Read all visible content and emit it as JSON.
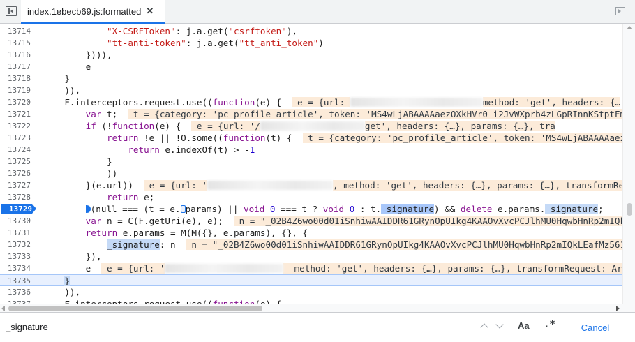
{
  "tab": {
    "title": "index.1ebecb69.js:formatted",
    "close_glyph": "✕"
  },
  "search": {
    "query": "_signature",
    "case_label": "Aa",
    "regex_label": ".*",
    "cancel_label": "Cancel"
  },
  "lines": [
    {
      "num": "13714",
      "code": [
        {
          "t": "            "
        },
        {
          "t": "\"X-CSRFToken\"",
          "c": "str"
        },
        {
          "t": ": j.a.get("
        },
        {
          "t": "\"csrftoken\"",
          "c": "str"
        },
        {
          "t": "),"
        }
      ]
    },
    {
      "num": "13715",
      "code": [
        {
          "t": "            "
        },
        {
          "t": "\"tt-anti-token\"",
          "c": "str"
        },
        {
          "t": ": j.a.get("
        },
        {
          "t": "\"tt_anti_token\"",
          "c": "str"
        },
        {
          "t": ")"
        }
      ]
    },
    {
      "num": "13716",
      "code": [
        {
          "t": "        }))),"
        }
      ]
    },
    {
      "num": "13717",
      "code": [
        {
          "t": "        e"
        }
      ]
    },
    {
      "num": "13718",
      "code": [
        {
          "t": "    }"
        }
      ]
    },
    {
      "num": "13719",
      "code": [
        {
          "t": "    )),"
        }
      ]
    },
    {
      "num": "13720",
      "code": [
        {
          "t": "    F.interceptors.request.use(("
        },
        {
          "t": "function",
          "c": "kw"
        },
        {
          "t": "(e) {  "
        },
        {
          "t": " e = {url: ",
          "c": "inl"
        },
        {
          "blur": 190
        },
        {
          "t": "method: 'get', headers: {…",
          "c": "inl"
        }
      ]
    },
    {
      "num": "13721",
      "code": [
        {
          "t": "        "
        },
        {
          "t": "var",
          "c": "kw"
        },
        {
          "t": " t;  "
        },
        {
          "t": " t = {category: 'pc_profile_article', token: 'MS4wLjABAAAAaezOXkHVr0_i2JvWXprb4zLGpRInnKStptFm",
          "c": "inl"
        }
      ]
    },
    {
      "num": "13722",
      "code": [
        {
          "t": "        "
        },
        {
          "t": "if",
          "c": "kw"
        },
        {
          "t": " (!"
        },
        {
          "t": "function",
          "c": "kw"
        },
        {
          "t": "(e) {  "
        },
        {
          "t": " e = {url: '/",
          "c": "inl"
        },
        {
          "blur": 150
        },
        {
          "t": "get', headers: {…}, params: {…}, tra",
          "c": "inl"
        }
      ]
    },
    {
      "num": "13723",
      "code": [
        {
          "t": "            "
        },
        {
          "t": "return",
          "c": "kw"
        },
        {
          "t": " !e || !O.some(("
        },
        {
          "t": "function",
          "c": "kw"
        },
        {
          "t": "(t) {  "
        },
        {
          "t": " t = {category: 'pc_profile_article', token: 'MS4wLjABAAAAaez",
          "c": "inl"
        }
      ]
    },
    {
      "num": "13724",
      "code": [
        {
          "t": "                "
        },
        {
          "t": "return",
          "c": "kw"
        },
        {
          "t": " e.indexOf(t) > -"
        },
        {
          "t": "1",
          "c": "num"
        }
      ]
    },
    {
      "num": "13725",
      "code": [
        {
          "t": "            }"
        }
      ]
    },
    {
      "num": "13726",
      "code": [
        {
          "t": "            ))"
        }
      ]
    },
    {
      "num": "13727",
      "code": [
        {
          "t": "        }(e.url))  "
        },
        {
          "t": " e = {url: '",
          "c": "inl"
        },
        {
          "blur": 180
        },
        {
          "t": ", method: 'get', headers: {…}, params: {…}, transformReq",
          "c": "inl"
        }
      ]
    },
    {
      "num": "13728",
      "code": [
        {
          "t": "            "
        },
        {
          "t": "return",
          "c": "kw"
        },
        {
          "t": " e;"
        }
      ]
    },
    {
      "num": "13729",
      "bp": true,
      "code": [
        {
          "t": "        "
        },
        {
          "mark": "arrow"
        },
        {
          "t": "(null === (t = e."
        },
        {
          "mark": "box"
        },
        {
          "t": "params) || "
        },
        {
          "t": "void",
          "c": "kw"
        },
        {
          "t": " "
        },
        {
          "t": "0",
          "c": "num"
        },
        {
          "t": " === t ? "
        },
        {
          "t": "void",
          "c": "kw"
        },
        {
          "t": " "
        },
        {
          "t": "0",
          "c": "num"
        },
        {
          "t": " : t."
        },
        {
          "t": "_signature",
          "c": "hl hit"
        },
        {
          "t": ") && "
        },
        {
          "t": "delete",
          "c": "kw"
        },
        {
          "t": " e.params."
        },
        {
          "t": "_signature",
          "c": "hl"
        },
        {
          "t": ";"
        }
      ]
    },
    {
      "num": "13730",
      "code": [
        {
          "t": "        "
        },
        {
          "t": "var",
          "c": "kw"
        },
        {
          "t": " n = C(F.getUri(e), e);  "
        },
        {
          "t": " n = \"_02B4Z6wo00d01iSnhiwAAIDDR61GRynOpUIkg4KAAOvXvcPCJlhMU0HqwbHnRp2mIQk",
          "c": "inl"
        }
      ]
    },
    {
      "num": "13731",
      "code": [
        {
          "t": "        "
        },
        {
          "t": "return",
          "c": "kw"
        },
        {
          "t": " e.params = M(M({}, e.params), {}, {"
        }
      ]
    },
    {
      "num": "13732",
      "code": [
        {
          "t": "            "
        },
        {
          "t": "_signature",
          "c": "hl"
        },
        {
          "t": ": n  "
        },
        {
          "t": " n = \"_02B4Z6wo00d01iSnhiwAAIDDR61GRynOpUIkg4KAAOvXvcPCJlhMU0HqwbHnRp2mIQkLEafMz561",
          "c": "inl"
        }
      ]
    },
    {
      "num": "13733",
      "code": [
        {
          "t": "        }),"
        }
      ]
    },
    {
      "num": "13734",
      "code": [
        {
          "t": "        e  "
        },
        {
          "t": " e = {url: '",
          "c": "inl"
        },
        {
          "blur": 170
        },
        {
          "t": "  method: 'get', headers: {…}, params: {…}, transformRequest: Ar",
          "c": "inl"
        }
      ]
    },
    {
      "num": "13735",
      "active": true,
      "code": [
        {
          "t": "    "
        },
        {
          "t": "}",
          "c": "sel"
        }
      ]
    },
    {
      "num": "13736",
      "code": [
        {
          "t": "    )),"
        }
      ]
    },
    {
      "num": "13737",
      "code": [
        {
          "t": "    F.interceptors.request.use(("
        },
        {
          "t": "function",
          "c": "kw"
        },
        {
          "t": "(e) {"
        }
      ]
    }
  ]
}
